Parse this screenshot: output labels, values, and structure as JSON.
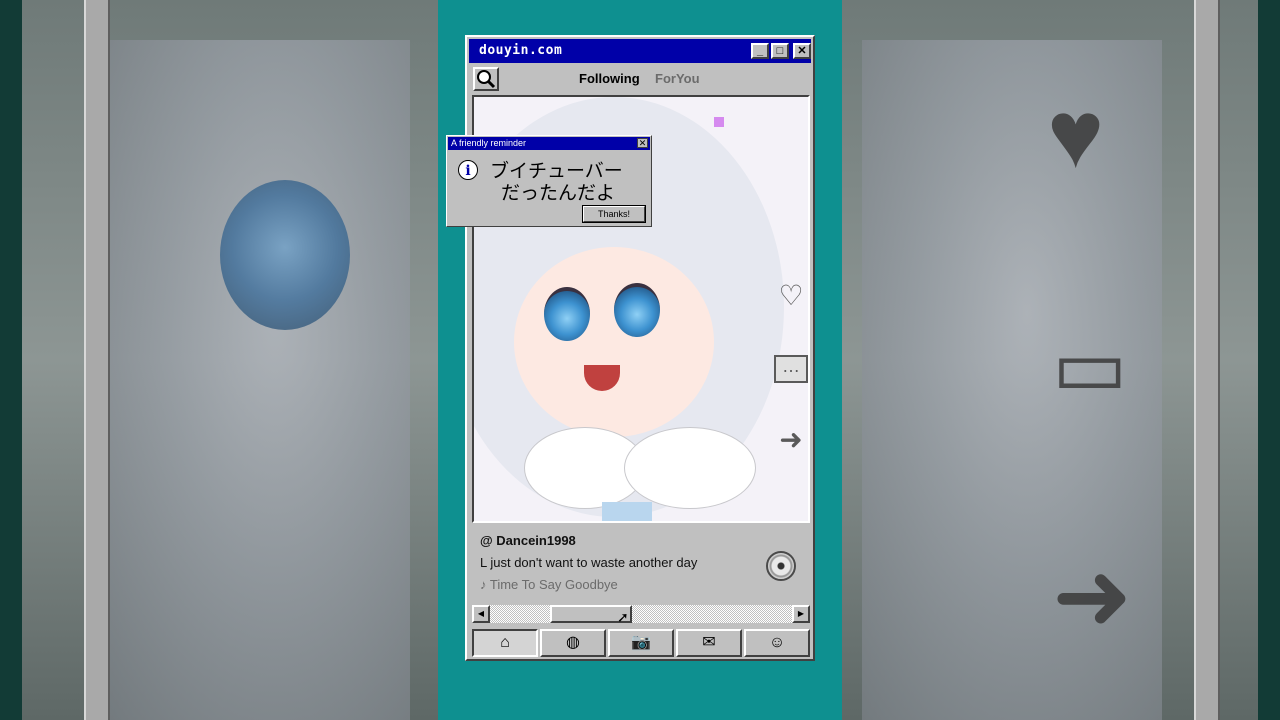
{
  "window": {
    "title": "douyin.com",
    "minimize_glyph": "_",
    "maximize_glyph": "□",
    "close_glyph": "✕"
  },
  "tabs": {
    "following": "Following",
    "foryou": "ForYou"
  },
  "dialog": {
    "title": "A friendly reminder",
    "close_glyph": "✕",
    "info_glyph": "i",
    "line1": "ブイチューバー",
    "line2": "だったんだよ",
    "button": "Thanks!"
  },
  "post": {
    "username": "@ Dancein1998",
    "caption": "L just don't want to waste another day",
    "music": "♪ Time To Say Goodbye"
  },
  "actions": {
    "like_glyph": "♡",
    "comment_glyph": "…",
    "share_glyph": "➜"
  },
  "scrollbar": {
    "left_glyph": "◀",
    "right_glyph": "▶"
  },
  "nav": {
    "home": "⌂",
    "explore": "◍",
    "camera": "📷",
    "inbox": "✉",
    "profile": "☺"
  },
  "colors": {
    "teal": "#0e9090",
    "titlebar": "#0000a8",
    "chrome": "#c0c0c0",
    "accent_purple": "#d58aef"
  }
}
